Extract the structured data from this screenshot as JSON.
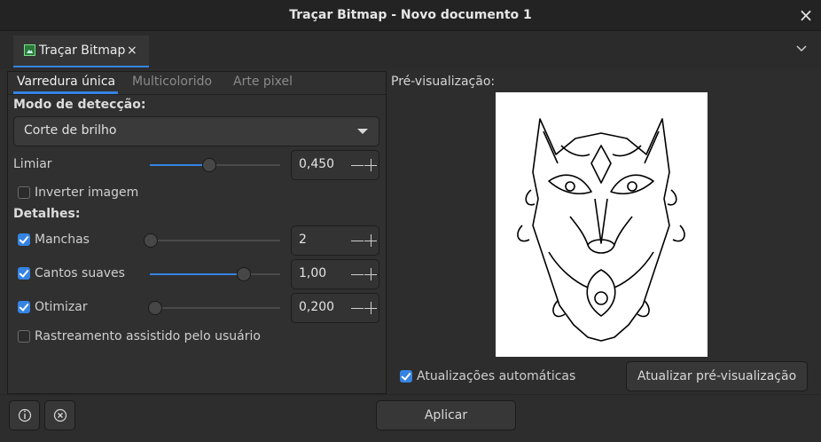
{
  "window": {
    "title": "Traçar Bitmap - Novo documento 1",
    "close_glyph": "×"
  },
  "dock": {
    "tab_label": "Traçar Bitmap",
    "tab_close_glyph": "×",
    "menu_chevron": "⌄"
  },
  "mode_tabs": [
    "Varredura única",
    "Multicolorido",
    "Arte pixel"
  ],
  "active_mode_tab": 0,
  "detection": {
    "section_title": "Modo de detecção:",
    "selected": "Corte de brilho",
    "threshold_label": "Limiar",
    "threshold_value": "0,450",
    "threshold_fraction": 0.45,
    "invert_label": "Inverter imagem",
    "invert_checked": false
  },
  "details": {
    "section_title": "Detalhes:",
    "speckles": {
      "label": "Manchas",
      "checked": true,
      "value": "2",
      "fraction": 0.0
    },
    "smooth": {
      "label": "Cantos suaves",
      "checked": true,
      "value": "1,00",
      "fraction": 0.75
    },
    "optimize": {
      "label": "Otimizar",
      "checked": true,
      "value": "0,200",
      "fraction": 0.0
    },
    "assisted": {
      "label": "Rastreamento assistido pelo usuário",
      "checked": false
    }
  },
  "preview": {
    "title": "Pré-visualização:",
    "auto_update_label": "Atualizações automáticas",
    "auto_update_checked": true,
    "update_button": "Atualizar pré-visualização"
  },
  "footer": {
    "apply_button": "Aplicar",
    "info_glyph": "i",
    "reset_glyph": "×"
  },
  "colors": {
    "accent": "#3584e4",
    "background": "#2d2d2d",
    "preview_bg": "#ffffff"
  }
}
